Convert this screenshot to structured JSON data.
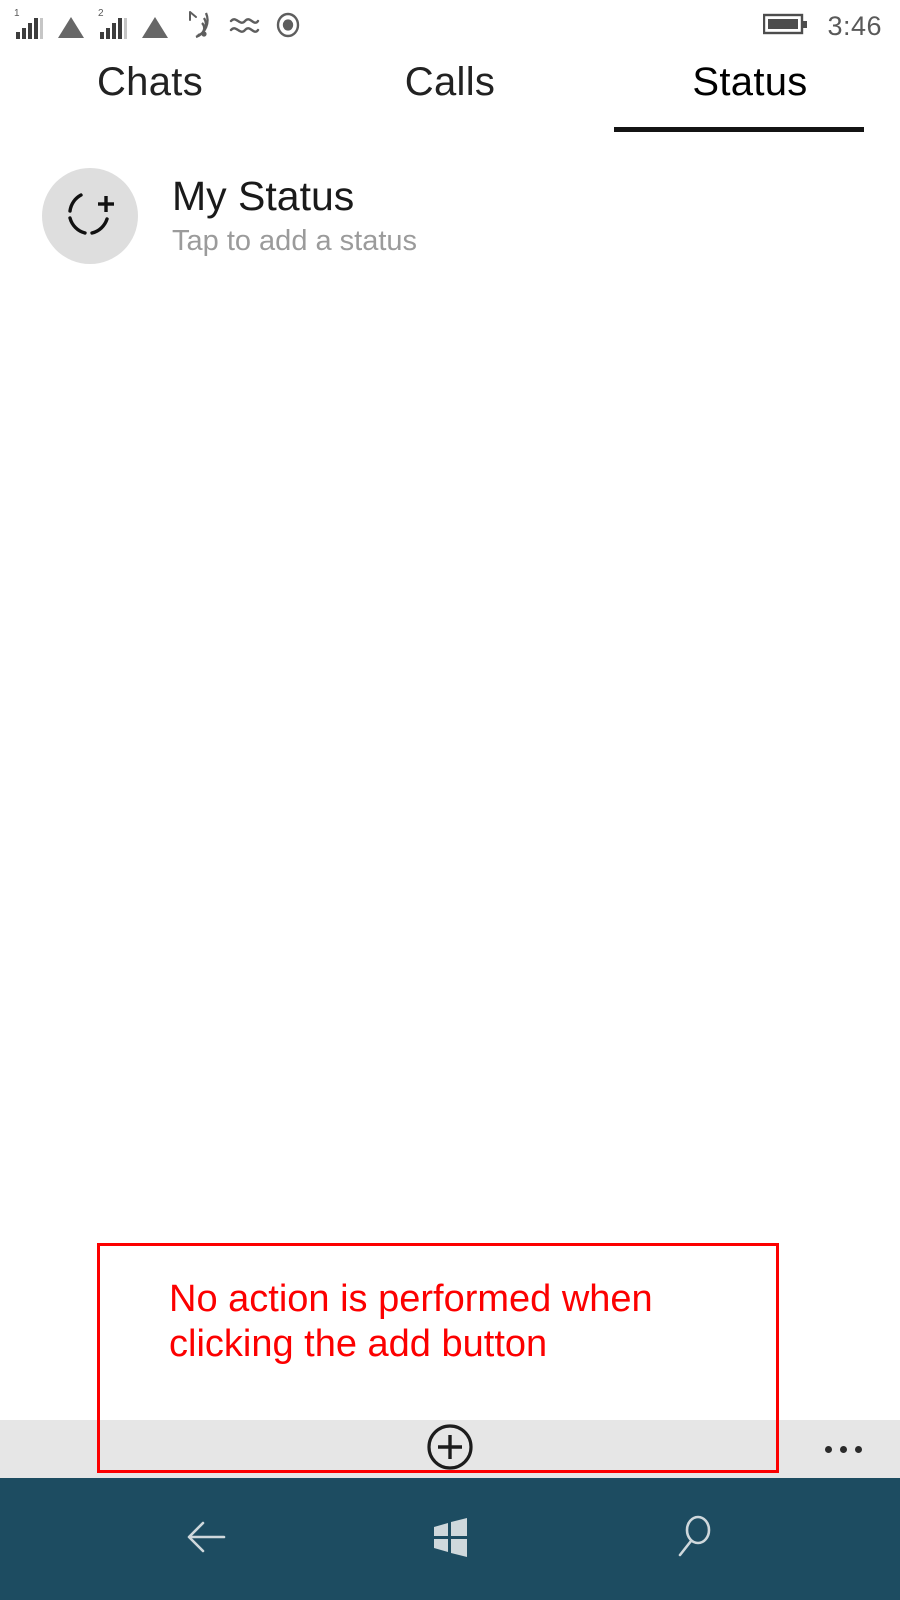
{
  "status_bar": {
    "signal_1_label": "1",
    "signal_2_label": "2",
    "icons": [
      "signal-bars-sim1-icon",
      "triangle-data-sim1-icon",
      "signal-bars-sim2-icon",
      "triangle-data-sim2-icon",
      "wifi-icon",
      "vibrate-icon",
      "record-icon"
    ],
    "battery_icon": "battery-full-icon",
    "time": "3:46"
  },
  "tabs": [
    {
      "label": "Chats",
      "active": false,
      "name": "tab-chats"
    },
    {
      "label": "Calls",
      "active": false,
      "name": "tab-calls"
    },
    {
      "label": "Status",
      "active": true,
      "name": "tab-status"
    }
  ],
  "my_status": {
    "avatar_icon": "add-status-camera-icon",
    "title": "My Status",
    "subtitle": "Tap to add a status"
  },
  "app_bar": {
    "add_button_icon": "add-circle-icon",
    "more_button_icon": "ellipsis-icon"
  },
  "nav_bar": {
    "back_icon": "back-arrow-icon",
    "home_icon": "windows-home-icon",
    "search_icon": "search-icon"
  },
  "annotation": {
    "text": "No action is performed when clicking the add button",
    "color": "#fc0000"
  },
  "colors": {
    "nav_bar_bg": "#1d4c61",
    "app_bar_bg": "#e6e6e6",
    "avatar_bg": "#dedede",
    "subtitle_gray": "#9b9b9b",
    "annotation_red": "#fc0000",
    "page_bg": "#ffffff"
  }
}
